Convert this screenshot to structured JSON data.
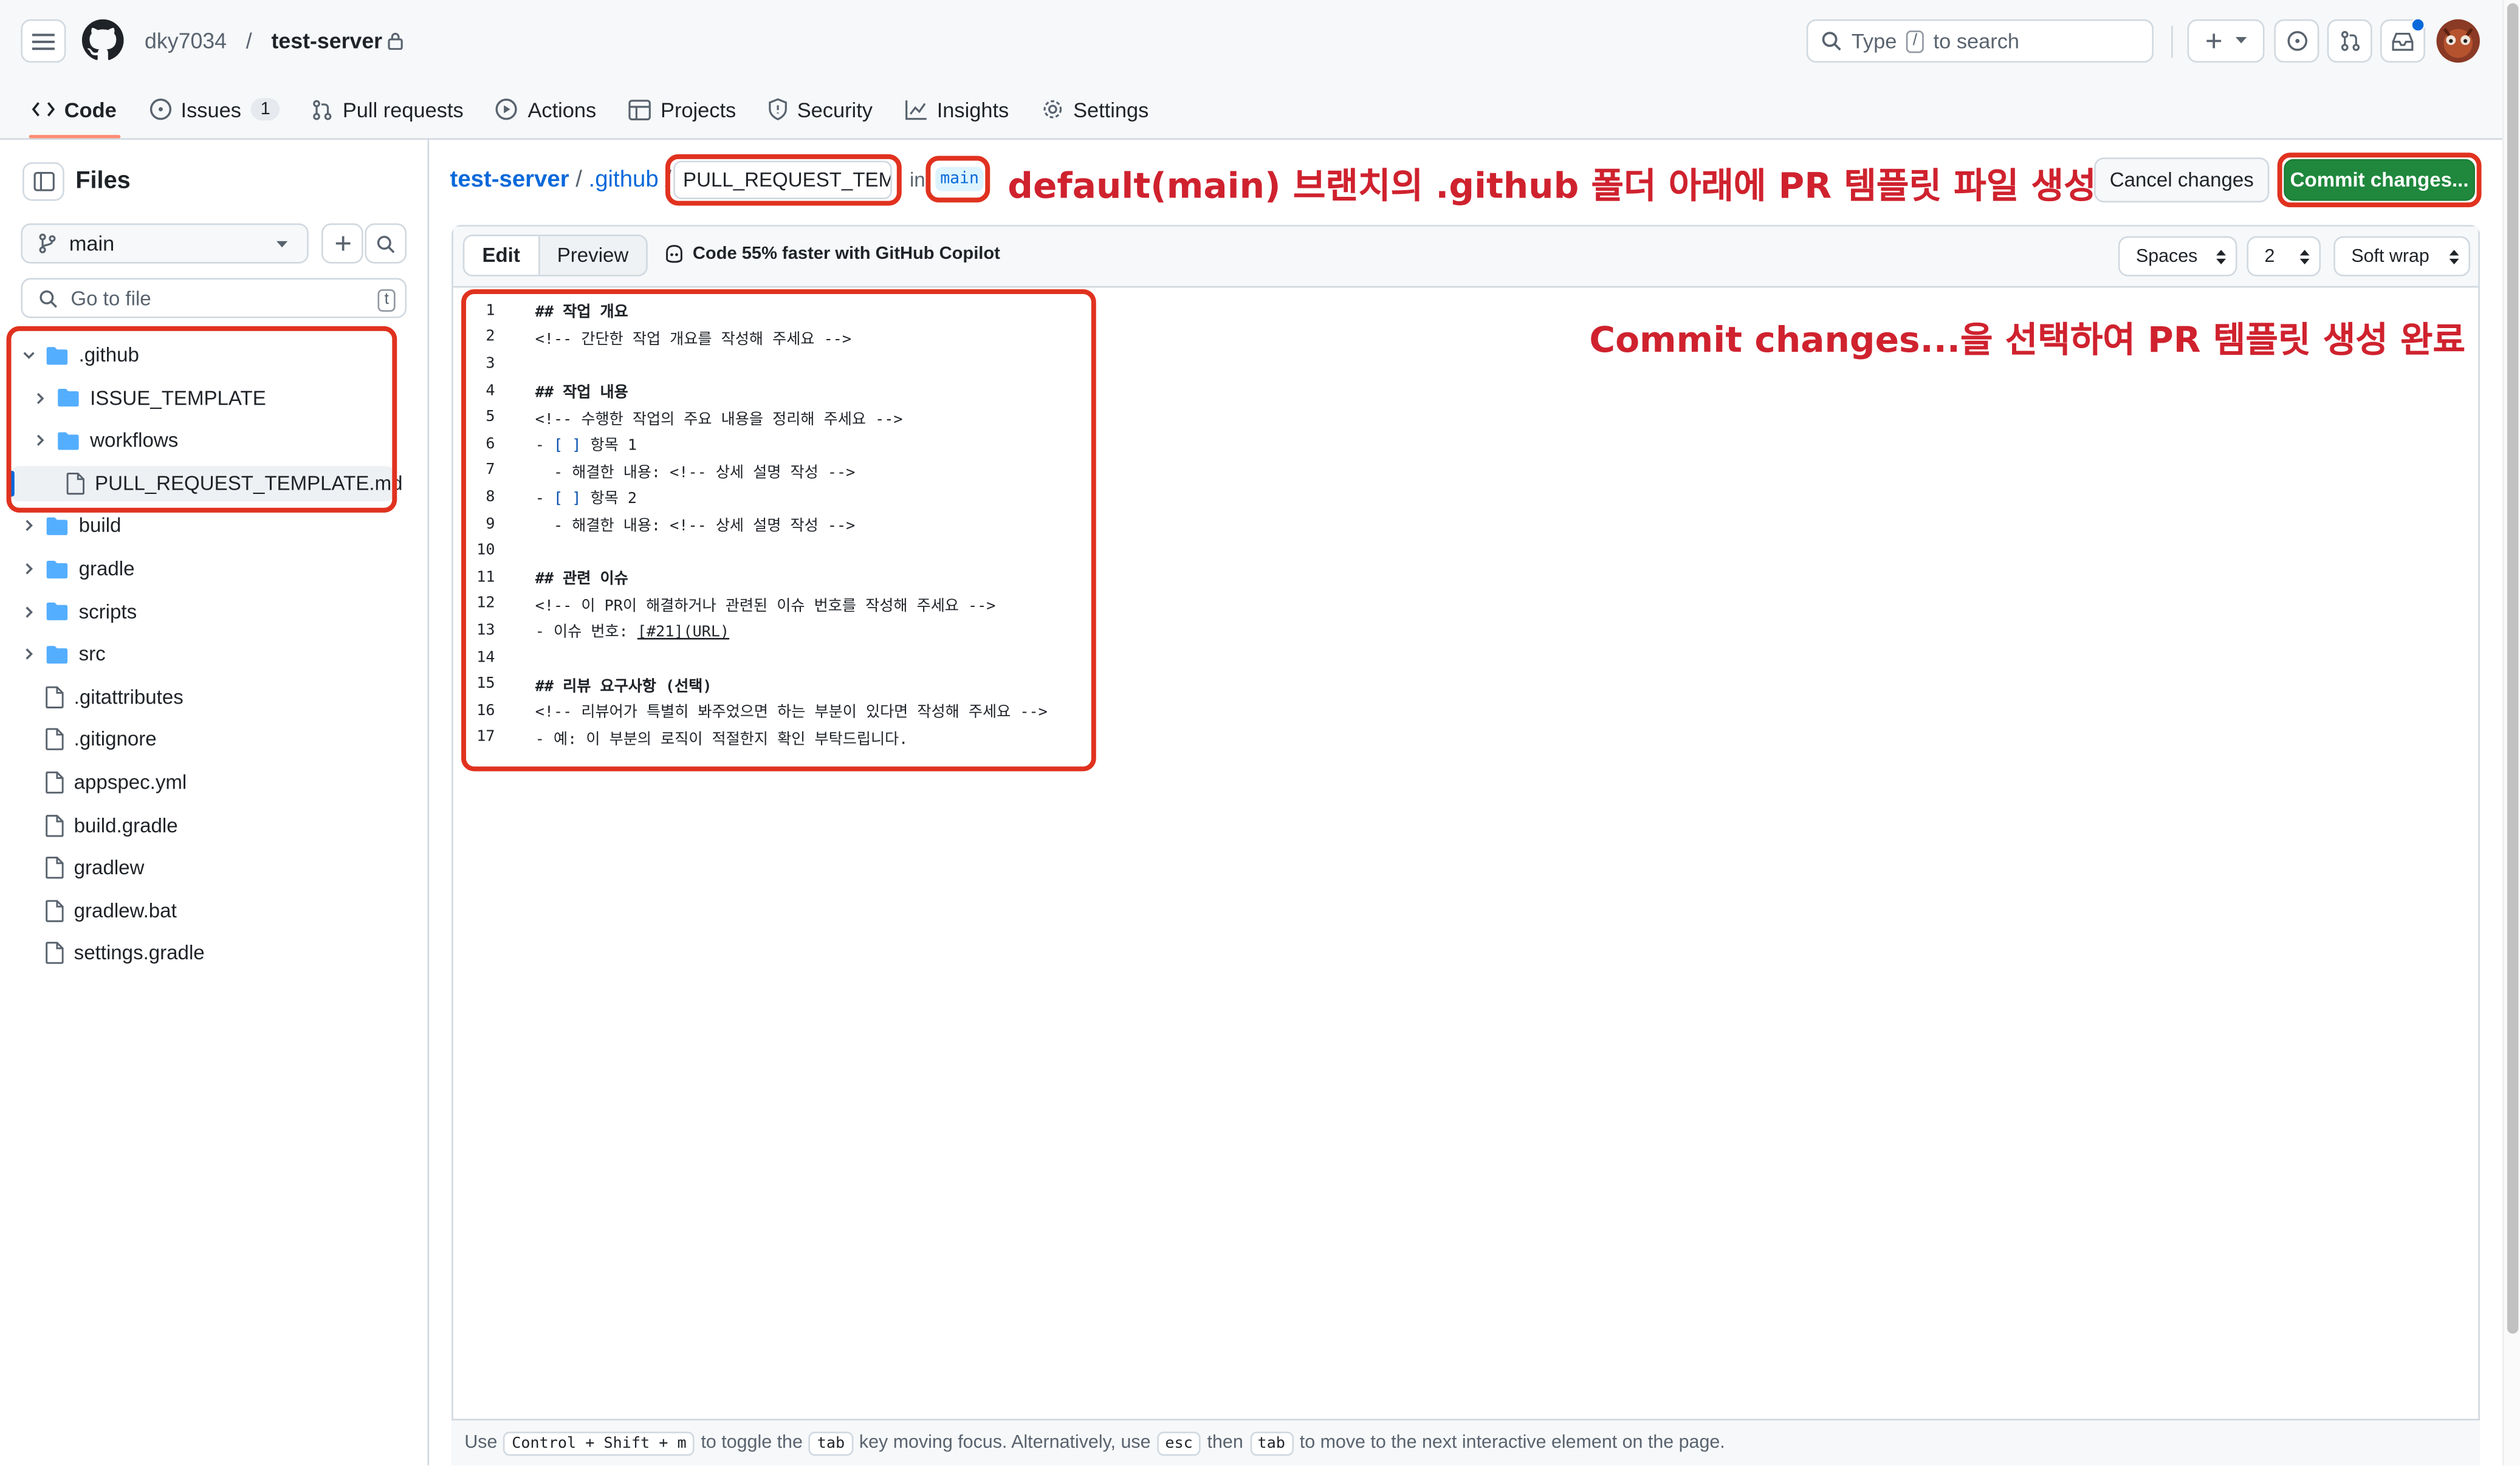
{
  "header": {
    "owner": "dky7034",
    "separator": "/",
    "repo": "test-server",
    "search_label": "Type",
    "search_key": "/",
    "search_suffix": "to search"
  },
  "tabs": [
    {
      "label": "Code",
      "icon": "code-icon"
    },
    {
      "label": "Issues",
      "icon": "issue-icon",
      "count": "1"
    },
    {
      "label": "Pull requests",
      "icon": "pull-request-icon"
    },
    {
      "label": "Actions",
      "icon": "play-icon"
    },
    {
      "label": "Projects",
      "icon": "table-icon"
    },
    {
      "label": "Security",
      "icon": "shield-icon"
    },
    {
      "label": "Insights",
      "icon": "graph-icon"
    },
    {
      "label": "Settings",
      "icon": "gear-icon"
    }
  ],
  "sidebar": {
    "title": "Files",
    "branch": "main",
    "goto_placeholder": "Go to file",
    "goto_shortcut": "t",
    "tree": [
      {
        "name": ".github",
        "type": "folder",
        "expanded": true,
        "depth": 0
      },
      {
        "name": "ISSUE_TEMPLATE",
        "type": "folder",
        "depth": 1
      },
      {
        "name": "workflows",
        "type": "folder",
        "depth": 1
      },
      {
        "name": "PULL_REQUEST_TEMPLATE.md",
        "type": "file",
        "depth": 1,
        "selected": true
      },
      {
        "name": "build",
        "type": "folder",
        "depth": 0
      },
      {
        "name": "gradle",
        "type": "folder",
        "depth": 0
      },
      {
        "name": "scripts",
        "type": "folder",
        "depth": 0
      },
      {
        "name": "src",
        "type": "folder",
        "depth": 0
      },
      {
        "name": ".gitattributes",
        "type": "file",
        "depth": 0
      },
      {
        "name": ".gitignore",
        "type": "file",
        "depth": 0
      },
      {
        "name": "appspec.yml",
        "type": "file",
        "depth": 0
      },
      {
        "name": "build.gradle",
        "type": "file",
        "depth": 0
      },
      {
        "name": "gradlew",
        "type": "file",
        "depth": 0
      },
      {
        "name": "gradlew.bat",
        "type": "file",
        "depth": 0
      },
      {
        "name": "settings.gradle",
        "type": "file",
        "depth": 0
      }
    ]
  },
  "breadcrumb": {
    "repo": "test-server",
    "folder": ".github",
    "filename": "PULL_REQUEST_TEMPL",
    "in_label": "in",
    "branch": "main"
  },
  "annotations": {
    "top": "default(main) 브랜치의 .github 폴더 아래에 PR 템플릿 파일 생성",
    "right": "Commit changes...을 선택하여 PR 템플릿 생성 완료"
  },
  "actions": {
    "cancel": "Cancel changes",
    "commit": "Commit changes..."
  },
  "editor": {
    "edit_tab": "Edit",
    "preview_tab": "Preview",
    "copilot": "Code 55% faster with GitHub Copilot",
    "indent_mode": "Spaces",
    "indent_size": "2",
    "wrap_mode": "Soft wrap",
    "lines": [
      "## 작업 개요",
      "<!-- 간단한 작업 개요를 작성해 주세요 -->",
      "",
      "## 작업 내용",
      "<!-- 수행한 작업의 주요 내용을 정리해 주세요 -->",
      "- [ ] 항목 1",
      "  - 해결한 내용: <!-- 상세 설명 작성 -->",
      "- [ ] 항목 2",
      "  - 해결한 내용: <!-- 상세 설명 작성 -->",
      "",
      "## 관련 이슈",
      "<!-- 이 PR이 해결하거나 관련된 이슈 번호를 작성해 주세요 -->",
      "- 이슈 번호: [#21](URL)",
      "",
      "## 리뷰 요구사항 (선택)",
      "<!-- 리뷰어가 특별히 봐주었으면 하는 부분이 있다면 작성해 주세요 -->",
      "- 예: 이 부분의 로직이 적절한지 확인 부탁드립니다."
    ]
  },
  "footer": {
    "t1": "Use",
    "k1": "Control + Shift + m",
    "t2": "to toggle the",
    "k2": "tab",
    "t3": "key moving focus. Alternatively, use",
    "k3": "esc",
    "t4": "then",
    "k4": "tab",
    "t5": "to move to the next interactive element on the page."
  },
  "colors": {
    "accent_link": "#0969da",
    "commit_green": "#1f883d",
    "annotation_red": "#e0321f",
    "tab_underline": "#fd8c73"
  }
}
